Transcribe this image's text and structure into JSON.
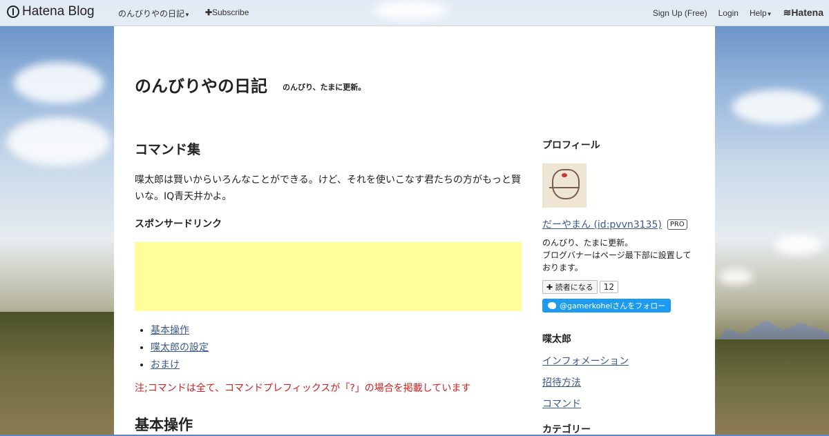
{
  "topbar": {
    "brand": "Hatena Blog",
    "blog_menu": "のんびりやの日記",
    "subscribe": "Subscribe",
    "signup": "Sign Up (Free)",
    "login": "Login",
    "help": "Help",
    "hatena": "Hatena"
  },
  "header": {
    "title": "のんびりやの日記",
    "description": "のんびり、たまに更新。"
  },
  "entry": {
    "title": "コマンド集",
    "paragraph": "喋太郎は賢いからいろんなことができる。けど、それを使いこなす君たちの方がもっと賢いな。IQ青天井かよ。",
    "sponsor_heading": "スポンサードリンク",
    "toc": [
      "基本操作",
      "喋太郎の設定",
      "おまけ"
    ],
    "note": "注;コマンドは全て、コマンドプレフィックスが「?」の場合を掲載しています",
    "section_heading": "基本操作"
  },
  "sidebar": {
    "profile_heading": "プロフィール",
    "profile_name": "だーやまん (id:pvvn3135)",
    "pro_badge": "PRO",
    "profile_desc_1": "のんびり、たまに更新。",
    "profile_desc_2": "ブログバナーはページ最下部に設置しております。",
    "reader_button": "読者になる",
    "reader_count": "12",
    "twitter_button": "@gamerkoheiさんをフォロー",
    "section2_heading": "喋太郎",
    "links": [
      "インフォメーション",
      "招待方法",
      "コマンド"
    ],
    "section3_heading": "カテゴリー"
  }
}
